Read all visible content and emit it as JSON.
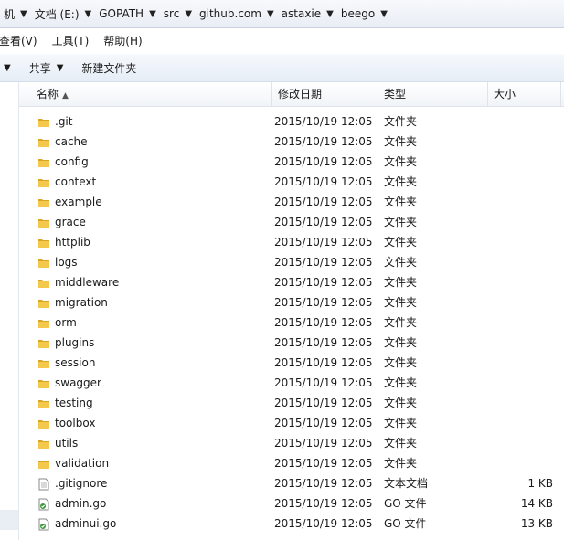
{
  "breadcrumb": [
    {
      "label": "机"
    },
    {
      "label": "文档 (E:)"
    },
    {
      "label": "GOPATH"
    },
    {
      "label": "src"
    },
    {
      "label": "github.com"
    },
    {
      "label": "astaxie"
    },
    {
      "label": "beego"
    }
  ],
  "menu": [
    "查看(V)",
    "工具(T)",
    "帮助(H)"
  ],
  "toolbar": {
    "share_label": "共享",
    "new_folder_label": "新建文件夹"
  },
  "columns": {
    "name": "名称",
    "date": "修改日期",
    "type": "类型",
    "size": "大小"
  },
  "files": [
    {
      "name": ".git",
      "date": "2015/10/19 12:05",
      "type": "文件夹",
      "size": "",
      "icon": "folder-icon"
    },
    {
      "name": "cache",
      "date": "2015/10/19 12:05",
      "type": "文件夹",
      "size": "",
      "icon": "folder-icon"
    },
    {
      "name": "config",
      "date": "2015/10/19 12:05",
      "type": "文件夹",
      "size": "",
      "icon": "folder-icon"
    },
    {
      "name": "context",
      "date": "2015/10/19 12:05",
      "type": "文件夹",
      "size": "",
      "icon": "folder-icon"
    },
    {
      "name": "example",
      "date": "2015/10/19 12:05",
      "type": "文件夹",
      "size": "",
      "icon": "folder-icon"
    },
    {
      "name": "grace",
      "date": "2015/10/19 12:05",
      "type": "文件夹",
      "size": "",
      "icon": "folder-icon"
    },
    {
      "name": "httplib",
      "date": "2015/10/19 12:05",
      "type": "文件夹",
      "size": "",
      "icon": "folder-icon"
    },
    {
      "name": "logs",
      "date": "2015/10/19 12:05",
      "type": "文件夹",
      "size": "",
      "icon": "folder-icon"
    },
    {
      "name": "middleware",
      "date": "2015/10/19 12:05",
      "type": "文件夹",
      "size": "",
      "icon": "folder-icon"
    },
    {
      "name": "migration",
      "date": "2015/10/19 12:05",
      "type": "文件夹",
      "size": "",
      "icon": "folder-icon"
    },
    {
      "name": "orm",
      "date": "2015/10/19 12:05",
      "type": "文件夹",
      "size": "",
      "icon": "folder-icon"
    },
    {
      "name": "plugins",
      "date": "2015/10/19 12:05",
      "type": "文件夹",
      "size": "",
      "icon": "folder-icon"
    },
    {
      "name": "session",
      "date": "2015/10/19 12:05",
      "type": "文件夹",
      "size": "",
      "icon": "folder-icon"
    },
    {
      "name": "swagger",
      "date": "2015/10/19 12:05",
      "type": "文件夹",
      "size": "",
      "icon": "folder-icon"
    },
    {
      "name": "testing",
      "date": "2015/10/19 12:05",
      "type": "文件夹",
      "size": "",
      "icon": "folder-icon"
    },
    {
      "name": "toolbox",
      "date": "2015/10/19 12:05",
      "type": "文件夹",
      "size": "",
      "icon": "folder-icon"
    },
    {
      "name": "utils",
      "date": "2015/10/19 12:05",
      "type": "文件夹",
      "size": "",
      "icon": "folder-icon"
    },
    {
      "name": "validation",
      "date": "2015/10/19 12:05",
      "type": "文件夹",
      "size": "",
      "icon": "folder-icon"
    },
    {
      "name": ".gitignore",
      "date": "2015/10/19 12:05",
      "type": "文本文档",
      "size": "1 KB",
      "icon": "text-file-icon"
    },
    {
      "name": "admin.go",
      "date": "2015/10/19 12:05",
      "type": "GO 文件",
      "size": "14 KB",
      "icon": "go-file-icon"
    },
    {
      "name": "adminui.go",
      "date": "2015/10/19 12:05",
      "type": "GO 文件",
      "size": "13 KB",
      "icon": "go-file-icon"
    }
  ],
  "colors": {
    "folder": "#f4c84a",
    "folder_dark": "#d9a524",
    "go_badge": "#3a9a3a"
  }
}
